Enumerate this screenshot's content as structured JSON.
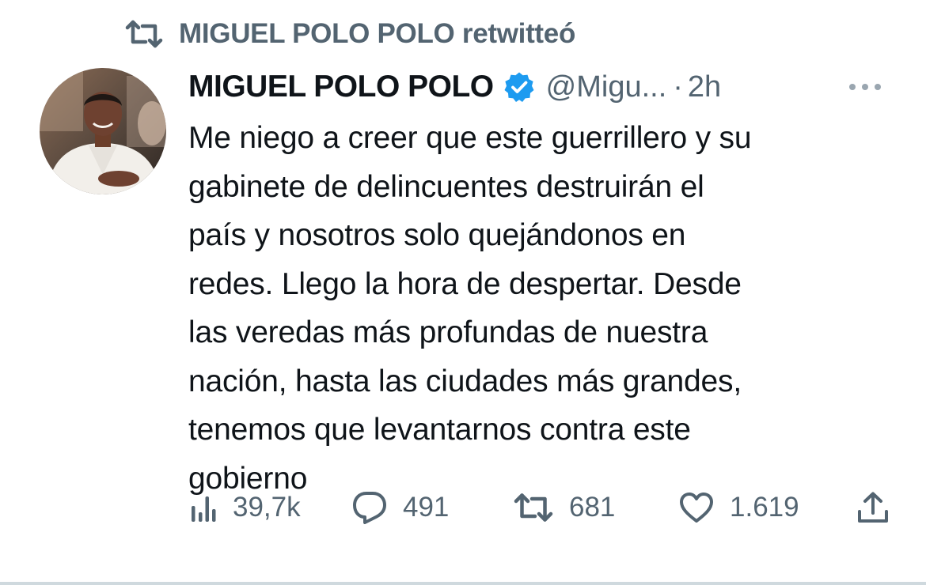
{
  "retweet_context": {
    "icon": "retweet-icon",
    "text": "MIGUEL POLO POLO retwitteó"
  },
  "tweet": {
    "author_name": "MIGUEL POLO POLO",
    "verified_icon": "verified-badge-icon",
    "handle": "@Migu...",
    "separator": "·",
    "timestamp": "2h",
    "more_icon": "more-options-icon",
    "text": "Me niego a creer que este guerrillero y su\ngabinete de delincuentes destruirán el\npaís y nosotros solo quejándonos en\nredes. Llego la hora de despertar. Desde\nlas veredas más profundas de nuestra\nnación, hasta las ciudades más grandes,\ntenemos que levantarnos contra este\ngobierno"
  },
  "actions": {
    "views": {
      "icon": "views-icon",
      "count": "39,7k"
    },
    "replies": {
      "icon": "reply-icon",
      "count": "491"
    },
    "retweets": {
      "icon": "retweet-icon",
      "count": "681"
    },
    "likes": {
      "icon": "heart-icon",
      "count": "1.619"
    },
    "share": {
      "icon": "share-icon"
    }
  },
  "colors": {
    "text_primary": "#0f1419",
    "text_secondary": "#536471",
    "verified_blue": "#1d9bf0",
    "divider": "#cfd9de"
  }
}
